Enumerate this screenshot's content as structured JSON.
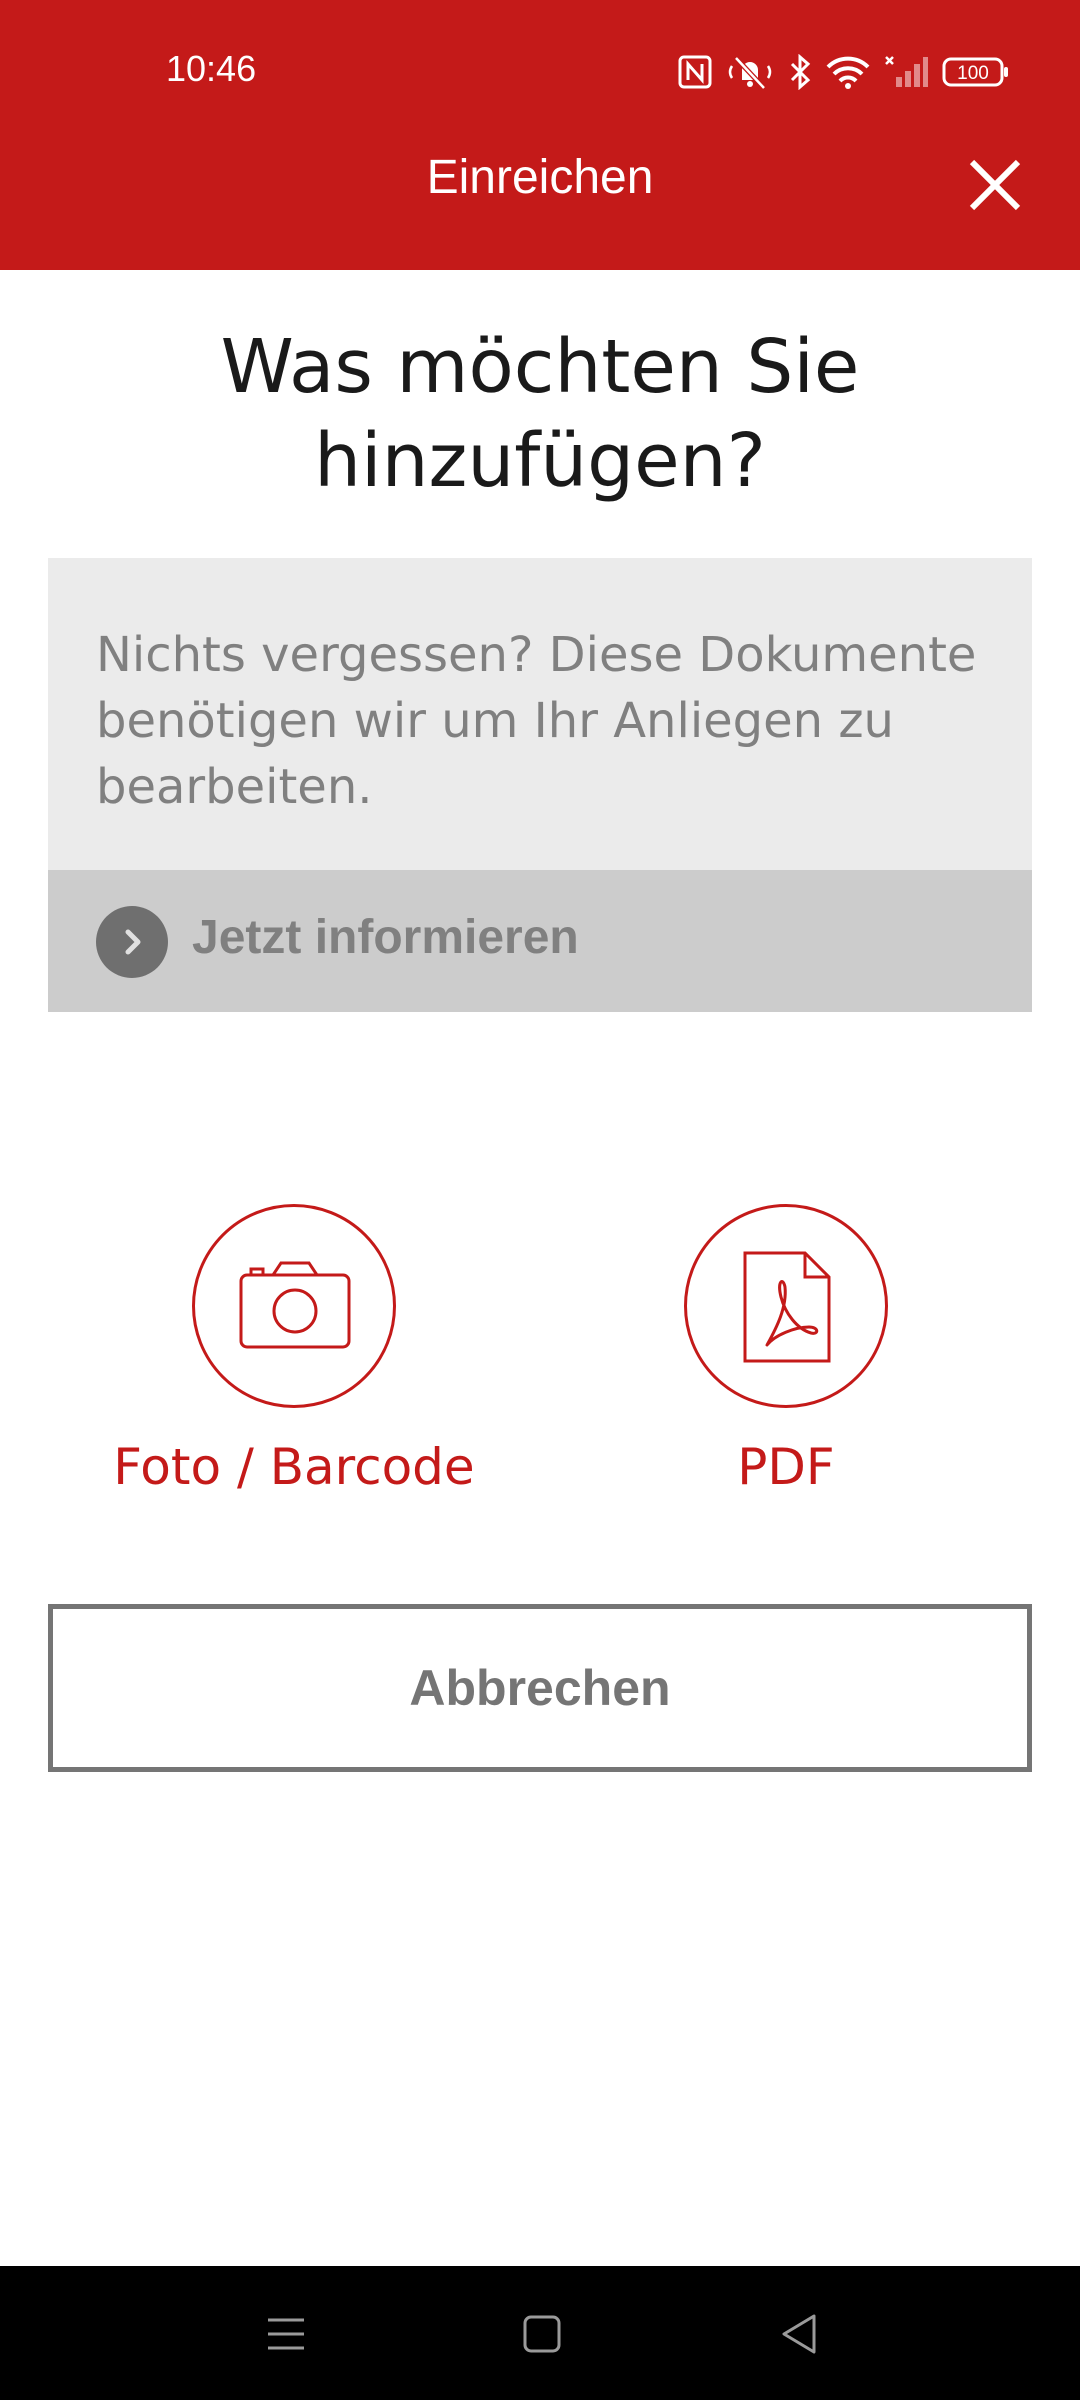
{
  "status_bar": {
    "time": "10:46",
    "battery": "100",
    "icons": [
      "nfc-icon",
      "mute-icon",
      "bluetooth-icon",
      "wifi-icon",
      "signal-icon",
      "battery-icon"
    ]
  },
  "header": {
    "title": "Einreichen",
    "close_icon": "close-icon",
    "background_color": "#c41a19"
  },
  "main": {
    "question": "Was möchten Sie hinzufügen?",
    "info": {
      "text": "Nichts vergessen? Diese Dokumente benötigen wir um Ihr Anliegen zu bearbeiten.",
      "link_label": "Jetzt informieren",
      "link_icon": "chevron-right-icon"
    },
    "options": [
      {
        "label": "Foto / Barcode",
        "icon": "camera-icon"
      },
      {
        "label": "PDF",
        "icon": "pdf-icon"
      }
    ],
    "cancel_label": "Abbrechen"
  },
  "nav_bar": {
    "icons": [
      "menu-icon",
      "home-icon",
      "back-icon"
    ]
  },
  "colors": {
    "accent": "#c41a19",
    "info_background": "#ebebeb",
    "link_background": "#cccccc",
    "muted_text": "#808080",
    "button_border": "#757575"
  }
}
